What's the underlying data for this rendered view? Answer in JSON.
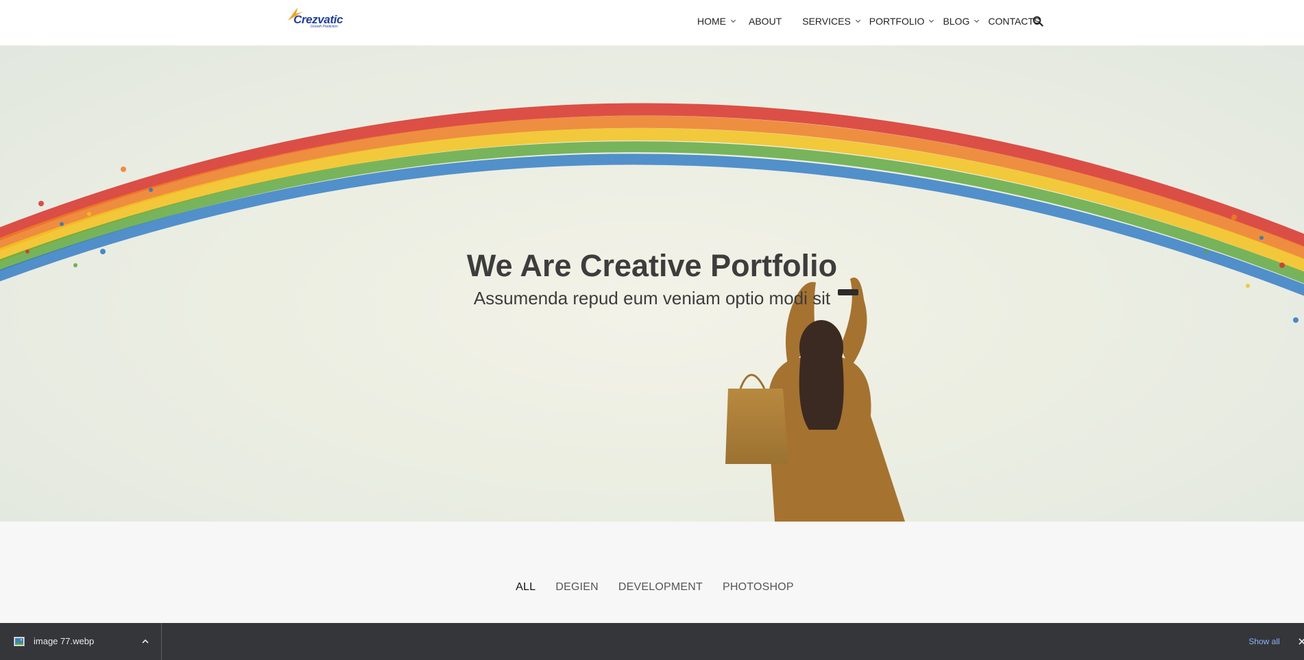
{
  "logo": {
    "name": "Crezvatic",
    "tagline": "Growth Prediction"
  },
  "nav": {
    "items": [
      {
        "label": "HOME",
        "dropdown": true
      },
      {
        "label": "ABOUT",
        "dropdown": false
      },
      {
        "label": "SERVICES",
        "dropdown": true
      },
      {
        "label": "PORTFOLIO",
        "dropdown": true
      },
      {
        "label": "BLOG",
        "dropdown": true
      },
      {
        "label": "CONTACTS",
        "dropdown": false
      }
    ],
    "search_icon": "search-icon"
  },
  "hero": {
    "title": "We Are Creative Portfolio",
    "subtitle": "Assumenda repud eum veniam optio modi sit"
  },
  "filters": {
    "items": [
      "ALL",
      "DEGIEN",
      "DEVELOPMENT",
      "PHOTOSHOP"
    ],
    "active": "ALL"
  },
  "downloads": {
    "file_name": "image 77.webp",
    "show_all": "Show all"
  },
  "colors": {
    "logo_blue": "#1f3fa8",
    "logo_orange": "#f5a21a",
    "download_bar": "#35363a",
    "link_blue": "#8ab4f8",
    "heading": "#3d3d3d"
  }
}
